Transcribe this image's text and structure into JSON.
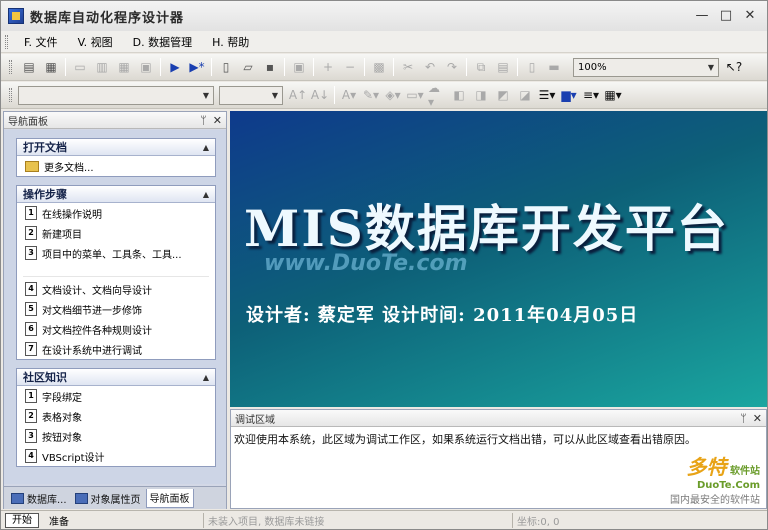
{
  "window": {
    "title": "数据库自动化程序设计器",
    "minimize": "—",
    "maximize": "□",
    "close": "✕"
  },
  "menu": [
    {
      "label": "F. 文件"
    },
    {
      "label": "V. 视图"
    },
    {
      "label": "D. 数据管理"
    },
    {
      "label": "H. 帮助"
    }
  ],
  "toolbar": {
    "zoom_value": "100%",
    "font_combo": "",
    "size_combo": ""
  },
  "nav_panel": {
    "title": "导航面板",
    "pin": "ᛘ",
    "close": "✕",
    "groups": {
      "open_doc": {
        "title": "打开文档",
        "items": [
          "更多文档..."
        ]
      },
      "steps": {
        "title": "操作步骤",
        "items_a": [
          {
            "num": "1",
            "label": "在线操作说明"
          },
          {
            "num": "2",
            "label": "新建项目"
          },
          {
            "num": "3",
            "label": "项目中的菜单、工具条、工具..."
          }
        ],
        "items_b": [
          {
            "num": "4",
            "label": "文档设计、文档向导设计"
          },
          {
            "num": "5",
            "label": "对文档细节进一步修饰"
          },
          {
            "num": "6",
            "label": "对文档控件各种规则设计"
          },
          {
            "num": "7",
            "label": "在设计系统中进行调试"
          }
        ]
      },
      "community": {
        "title": "社区知识",
        "items": [
          {
            "num": "1",
            "label": "字段绑定"
          },
          {
            "num": "2",
            "label": "表格对象"
          },
          {
            "num": "3",
            "label": "按钮对象"
          },
          {
            "num": "4",
            "label": "VBScript设计"
          }
        ]
      }
    },
    "tabs": [
      "数据库...",
      "对象属性页",
      "导航面板"
    ]
  },
  "splash": {
    "title": "MIS数据库开发平台",
    "watermark": "www.DuoTe.com",
    "designer": "设计者: 蔡定军   设计时间: 2011年04月05日"
  },
  "debug": {
    "title": "调试区域",
    "message": "欢迎使用本系统，此区域为调试工作区，如果系统运行文档出错，可以从此区域查看出错原因。",
    "watermark_logo": "多特",
    "watermark_sub": "软件站",
    "watermark_url": "DuoTe.Com",
    "watermark_tag": "国内最安全的软件站"
  },
  "status": {
    "start": "开始",
    "ready": "准备",
    "project": "未装入项目, 数据库未链接",
    "coord": "坐标:0, 0"
  }
}
